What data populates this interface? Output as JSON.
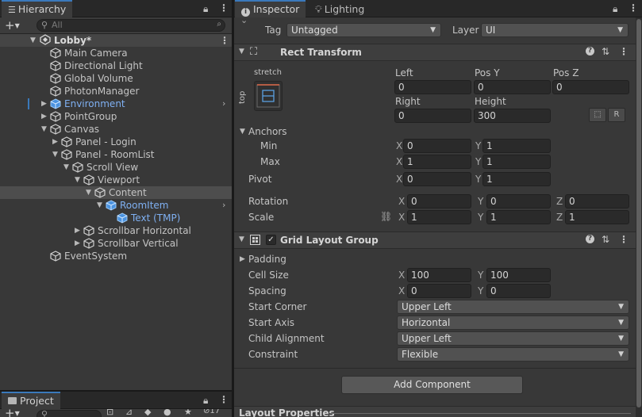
{
  "hierarchy": {
    "tab_label": "Hierarchy",
    "search_placeholder": "All",
    "scene_name": "Lobby*",
    "items": [
      {
        "label": "Main Camera",
        "depth": 0,
        "arrow": "",
        "blue": false,
        "selected": false
      },
      {
        "label": "Directional Light",
        "depth": 0,
        "arrow": "",
        "blue": false,
        "selected": false
      },
      {
        "label": "Global Volume",
        "depth": 0,
        "arrow": "",
        "blue": false,
        "selected": false
      },
      {
        "label": "PhotonManager",
        "depth": 0,
        "arrow": "",
        "blue": false,
        "selected": false
      },
      {
        "label": "Environment",
        "depth": 0,
        "arrow": "right",
        "blue": true,
        "selected": false
      },
      {
        "label": "PointGroup",
        "depth": 0,
        "arrow": "right",
        "blue": false,
        "selected": false
      },
      {
        "label": "Canvas",
        "depth": 0,
        "arrow": "down",
        "blue": false,
        "selected": false
      },
      {
        "label": "Panel - Login",
        "depth": 1,
        "arrow": "right",
        "blue": false,
        "selected": false
      },
      {
        "label": "Panel - RoomList",
        "depth": 1,
        "arrow": "down",
        "blue": false,
        "selected": false
      },
      {
        "label": "Scroll View",
        "depth": 2,
        "arrow": "down",
        "blue": false,
        "selected": false
      },
      {
        "label": "Viewport",
        "depth": 3,
        "arrow": "down",
        "blue": false,
        "selected": false
      },
      {
        "label": "Content",
        "depth": 4,
        "arrow": "down",
        "blue": false,
        "selected": true
      },
      {
        "label": "RoomItem",
        "depth": 5,
        "arrow": "down",
        "blue": true,
        "selected": false
      },
      {
        "label": "Text (TMP)",
        "depth": 6,
        "arrow": "",
        "blue": true,
        "selected": false
      },
      {
        "label": "Scrollbar Horizontal",
        "depth": 3,
        "arrow": "right",
        "blue": false,
        "selected": false
      },
      {
        "label": "Scrollbar Vertical",
        "depth": 3,
        "arrow": "right",
        "blue": false,
        "selected": false
      },
      {
        "label": "EventSystem",
        "depth": 0,
        "arrow": "",
        "blue": false,
        "selected": false
      }
    ]
  },
  "project": {
    "tab_label": "Project",
    "search_value": "",
    "count": "17"
  },
  "inspector": {
    "tab_label": "Inspector",
    "lighting_tab_label": "Lighting",
    "tag_label": "Tag",
    "tag_value": "Untagged",
    "layer_label": "Layer",
    "layer_value": "UI",
    "rect_transform": {
      "title": "Rect Transform",
      "anchor_h": "stretch",
      "anchor_v": "top",
      "left_label": "Left",
      "left_value": "0",
      "posy_label": "Pos Y",
      "posy_value": "0",
      "posz_label": "Pos Z",
      "posz_value": "0",
      "right_label": "Right",
      "right_value": "0",
      "height_label": "Height",
      "height_value": "300",
      "r_button": "R",
      "anchors_label": "Anchors",
      "min_label": "Min",
      "min_x": "0",
      "min_y": "1",
      "max_label": "Max",
      "max_x": "1",
      "max_y": "1",
      "pivot_label": "Pivot",
      "pivot_x": "0",
      "pivot_y": "1",
      "rotation_label": "Rotation",
      "rot_x": "0",
      "rot_y": "0",
      "rot_z": "0",
      "scale_label": "Scale",
      "scale_x": "1",
      "scale_y": "1",
      "scale_z": "1",
      "x": "X",
      "y": "Y",
      "z": "Z"
    },
    "grid_layout": {
      "title": "Grid Layout Group",
      "padding_label": "Padding",
      "cell_size_label": "Cell Size",
      "cell_x": "100",
      "cell_y": "100",
      "spacing_label": "Spacing",
      "spacing_x": "0",
      "spacing_y": "0",
      "start_corner_label": "Start Corner",
      "start_corner": "Upper Left",
      "start_axis_label": "Start Axis",
      "start_axis": "Horizontal",
      "child_alignment_label": "Child Alignment",
      "child_alignment": "Upper Left",
      "constraint_label": "Constraint",
      "constraint": "Flexible"
    },
    "add_component": "Add Component",
    "layout_properties": "Layout Properties"
  },
  "colors": {
    "accent": "#3a79bb",
    "blue_text": "#7fb0f2",
    "selection": "#4d4d4d"
  }
}
